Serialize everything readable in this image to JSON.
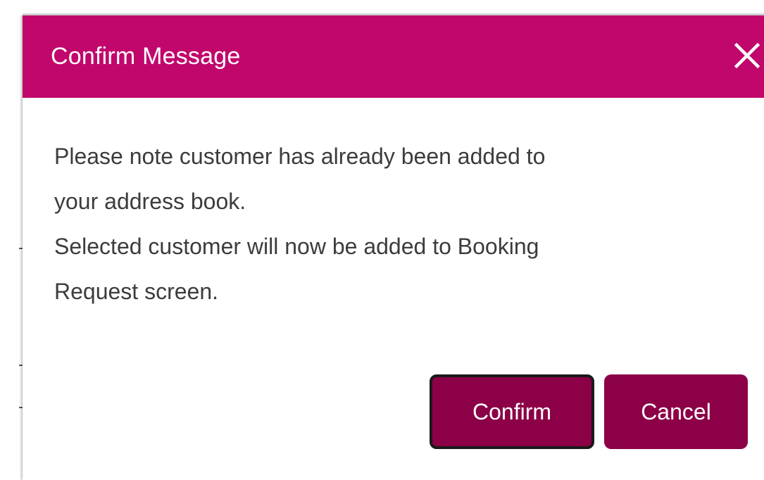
{
  "dialog": {
    "title": "Confirm Message",
    "close_icon": "close-icon",
    "message_lines": [
      "Please note customer has already been added to",
      "your address book.",
      "Selected customer will now be added to Booking",
      "Request screen."
    ],
    "confirm_label": "Confirm",
    "cancel_label": "Cancel"
  },
  "colors": {
    "header_bg": "#c1076c",
    "button_bg": "#8c0047",
    "body_text": "#3c3c3c"
  }
}
